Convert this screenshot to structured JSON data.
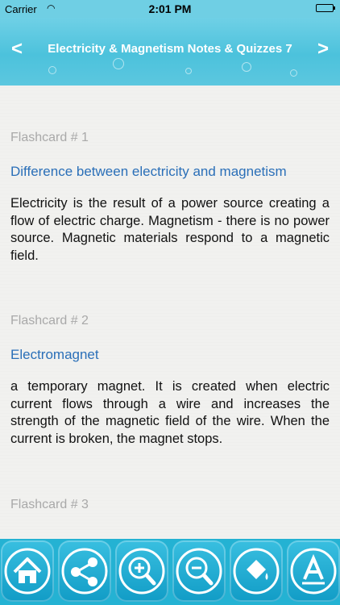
{
  "status_bar": {
    "carrier": "Carrier",
    "time": "2:01 PM"
  },
  "nav": {
    "title": "Electricity & Magnetism Notes & Quizzes 7",
    "back": "<",
    "forward": ">"
  },
  "flashcards": [
    {
      "label": "Flashcard # 1",
      "title": "Difference between electricity and magnetism",
      "body": "Electricity is the result of a power source creating a flow of electric charge. Magnetism - there is no power source. Magnetic materials respond to a magnetic field."
    },
    {
      "label": "Flashcard # 2",
      "title": "Electromagnet",
      "body": "a temporary magnet. It is created when electric current flows through a wire and increases the strength of the magnetic field of the wire. When the current is broken, the magnet stops."
    },
    {
      "label": "Flashcard # 3",
      "title": "",
      "body": ""
    }
  ],
  "toolbar": {
    "icons": [
      "home-icon",
      "share-icon",
      "zoom-in-icon",
      "zoom-out-icon",
      "paint-bucket-icon",
      "font-icon"
    ]
  }
}
